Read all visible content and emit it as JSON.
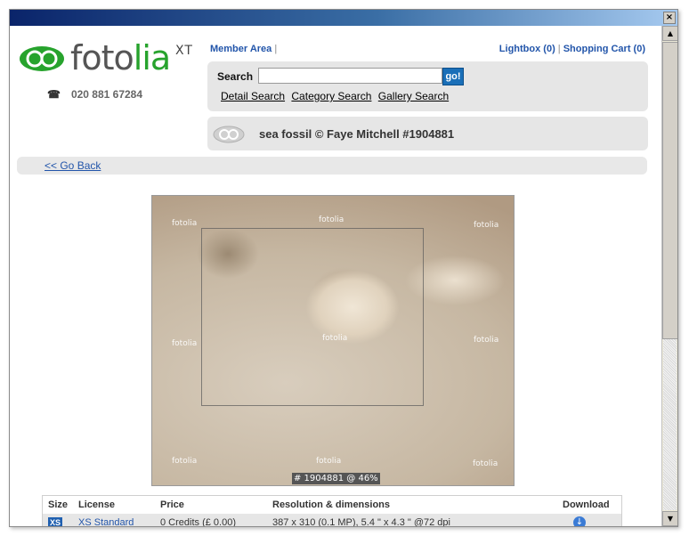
{
  "window": {
    "close_label": "×"
  },
  "scrollbar": {
    "up": "▲",
    "down": "▼"
  },
  "header": {
    "logo_main": "foto",
    "logo_green": "lia",
    "logo_sup": "XT",
    "phone": "020 881 67284",
    "member_area": "Member Area",
    "separator": "|",
    "lightbox": "Lightbox (0)",
    "shopping_cart": "Shopping Cart (0)"
  },
  "search": {
    "label": "Search",
    "value": "",
    "placeholder": "",
    "go": "go!",
    "links": [
      "Detail Search",
      "Category Search",
      "Gallery Search"
    ]
  },
  "image_title": "sea fossil © Faye Mitchell #1904881",
  "back_link": "<< Go Back",
  "photo": {
    "watermark": "fotolia",
    "caption": "# 1904881 @ 46%"
  },
  "table": {
    "headers": [
      "Size",
      "License",
      "Price",
      "Resolution & dimensions",
      "Download"
    ],
    "rows": [
      {
        "size": "XS",
        "license": "XS Standard",
        "price": "0 Credits (£ 0.00)",
        "resolution": "387 x 310 (0.1 MP), 5.4 \" x 4.3 \" @72 dpi"
      }
    ]
  },
  "colors": {
    "brand_green": "#27a32d",
    "link_blue": "#2255aa",
    "titlebar": "#0a246a"
  }
}
